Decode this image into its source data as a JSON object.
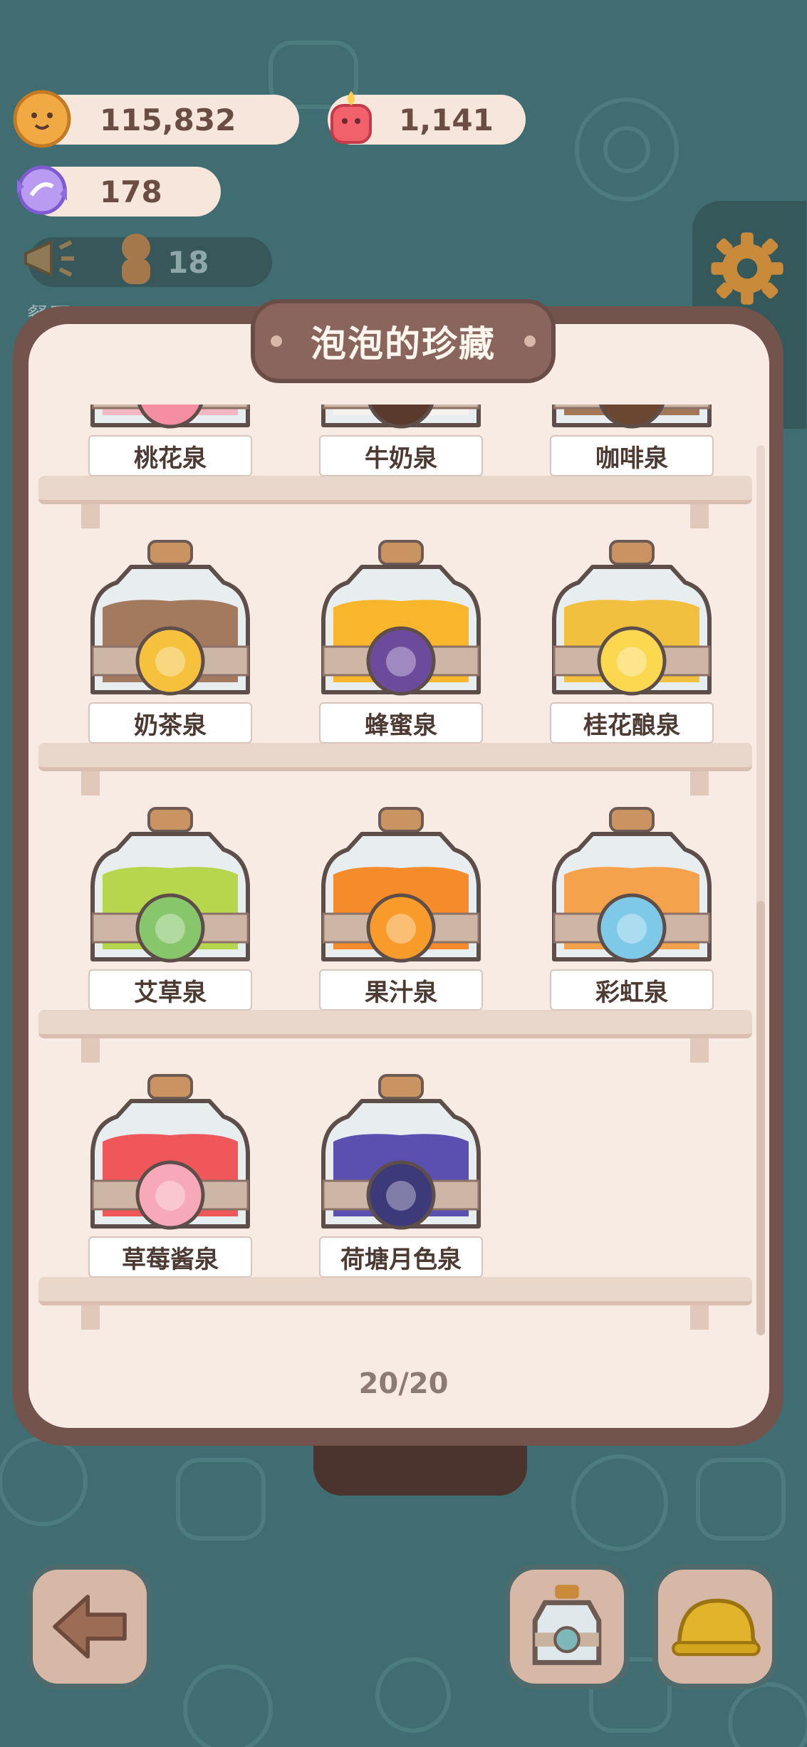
{
  "hud": {
    "cookies": "115,832",
    "candles": "1,141",
    "candy": "178",
    "tickets": "18",
    "partial_text": "餐厅"
  },
  "panel": {
    "title": "泡泡的珍藏",
    "counter": "20/20"
  },
  "springs": [
    {
      "name": "桃花泉",
      "liquid": "#f3b8c4",
      "emblem": "#f48ea3"
    },
    {
      "name": "牛奶泉",
      "liquid": "#f6f2ee",
      "emblem": "#5a3a2c"
    },
    {
      "name": "咖啡泉",
      "liquid": "#a27858",
      "emblem": "#6b4630"
    },
    {
      "name": "奶茶泉",
      "liquid": "#a47a5f",
      "emblem": "#f6c23d",
      "emblem_icon": "bubble-tea-icon"
    },
    {
      "name": "蜂蜜泉",
      "liquid": "#f9b62d",
      "emblem": "#6d4b9c",
      "emblem_icon": "bee-icon"
    },
    {
      "name": "桂花酿泉",
      "liquid": "#f1c03e",
      "emblem": "#fbd84f",
      "emblem_icon": "osmanthus-flower-icon"
    },
    {
      "name": "艾草泉",
      "liquid": "#b6d64d",
      "emblem": "#88c66b",
      "emblem_icon": "mugwort-leaf-icon"
    },
    {
      "name": "果汁泉",
      "liquid": "#f58b2a",
      "emblem": "#f89b2a",
      "emblem_icon": "orange-slice-icon"
    },
    {
      "name": "彩虹泉",
      "liquid": "#f4a24b",
      "emblem": "#7ec9e8",
      "emblem_icon": "rainbow-icon"
    },
    {
      "name": "草莓酱泉",
      "liquid": "#f0575a",
      "emblem": "#f7a9b9",
      "emblem_icon": "strawberry-icon"
    },
    {
      "name": "荷塘月色泉",
      "liquid": "#5b4fb0",
      "emblem": "#3d3a7a",
      "emblem_icon": "lotus-moon-icon"
    }
  ]
}
